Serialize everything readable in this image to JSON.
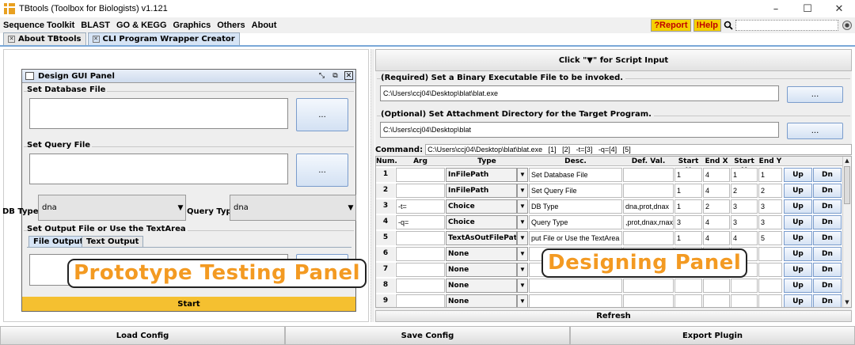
{
  "window": {
    "title": "TBtools (Toolbox for Biologists) v1.121",
    "controls": {
      "minimize": "–",
      "maximize": "☐",
      "close": "✕"
    }
  },
  "menu": {
    "items": [
      "Sequence Toolkit",
      "BLAST",
      "GO & KEGG",
      "Graphics",
      "Others",
      "About"
    ],
    "report_label": "?Report",
    "help_label": "!Help"
  },
  "tabs": [
    {
      "label": "About TBtools",
      "active": false
    },
    {
      "label": "CLI Program Wrapper Creator",
      "active": true
    }
  ],
  "gui_panel": {
    "title": "Design GUI Panel",
    "database_label": "Set Database File",
    "query_label": "Set Query File",
    "dots_label": "...",
    "db_type_label": "DB Type:",
    "db_type_value": "dna",
    "query_type_label": "Query Type:",
    "query_type_value": "dna",
    "output_label": "Set Output File or Use the TextArea",
    "output_tabs": [
      "File Output",
      "Text Output"
    ],
    "start_label": "Start"
  },
  "overlays": {
    "prototype": "Prototype Testing Panel",
    "designing": "Designing Panel"
  },
  "designer": {
    "script_button": "Click \"▼\" for Script Input",
    "binary_label": "(Required) Set a Binary Executable File to be invoked.",
    "binary_path": "C:\\Users\\ccj04\\Desktop\\blat\\blat.exe",
    "attach_label": "(Optional) Set Attachment Directory for the Target Program.",
    "attach_path": "C:\\Users\\ccj04\\Desktop\\blat",
    "dots_label": "...",
    "command_label": "Command:",
    "command_value": "C:\\Users\\ccj04\\Desktop\\blat\\blat.exe   [1]   [2]   -t=[3]   -q=[4]   [5]",
    "refresh_label": "Refresh"
  },
  "table": {
    "headers": [
      "Num.",
      "Arg",
      "Type",
      "Desc.",
      "Def. Val.",
      "Start X",
      "End X",
      "Start Y",
      "End Y"
    ],
    "up_label": "Up",
    "dn_label": "Dn",
    "rows": [
      {
        "num": "1",
        "arg": "",
        "type": "InFilePath",
        "desc": "Set Database File",
        "def": "",
        "sx": "1",
        "ex": "4",
        "sy": "1",
        "ey": "1"
      },
      {
        "num": "2",
        "arg": "",
        "type": "InFilePath",
        "desc": "Set Query File",
        "def": "",
        "sx": "1",
        "ex": "4",
        "sy": "2",
        "ey": "2"
      },
      {
        "num": "3",
        "arg": "-t=",
        "type": "Choice",
        "desc": "DB Type",
        "def": "dna,prot,dnax",
        "sx": "1",
        "ex": "2",
        "sy": "3",
        "ey": "3"
      },
      {
        "num": "4",
        "arg": "-q=",
        "type": "Choice",
        "desc": "Query Type",
        "def": ",prot,dnax,rnax",
        "sx": "3",
        "ex": "4",
        "sy": "3",
        "ey": "3"
      },
      {
        "num": "5",
        "arg": "",
        "type": "TextAsOutFilePath",
        "desc": "put File or Use the TextArea",
        "def": "",
        "sx": "1",
        "ex": "4",
        "sy": "4",
        "ey": "5"
      },
      {
        "num": "6",
        "arg": "",
        "type": "None",
        "desc": "",
        "def": "",
        "sx": "",
        "ex": "",
        "sy": "",
        "ey": ""
      },
      {
        "num": "7",
        "arg": "",
        "type": "None",
        "desc": "",
        "def": "",
        "sx": "",
        "ex": "",
        "sy": "",
        "ey": ""
      },
      {
        "num": "8",
        "arg": "",
        "type": "None",
        "desc": "",
        "def": "",
        "sx": "",
        "ex": "",
        "sy": "",
        "ey": ""
      },
      {
        "num": "9",
        "arg": "",
        "type": "None",
        "desc": "",
        "def": "",
        "sx": "",
        "ex": "",
        "sy": "",
        "ey": ""
      }
    ]
  },
  "bottom": {
    "load_label": "Load Config",
    "save_label": "Save Config",
    "export_label": "Export Plugin"
  },
  "colors": {
    "accent_orange": "#f39a22",
    "start_yellow": "#f5c030",
    "tab_blue": "#7aa8d8"
  }
}
